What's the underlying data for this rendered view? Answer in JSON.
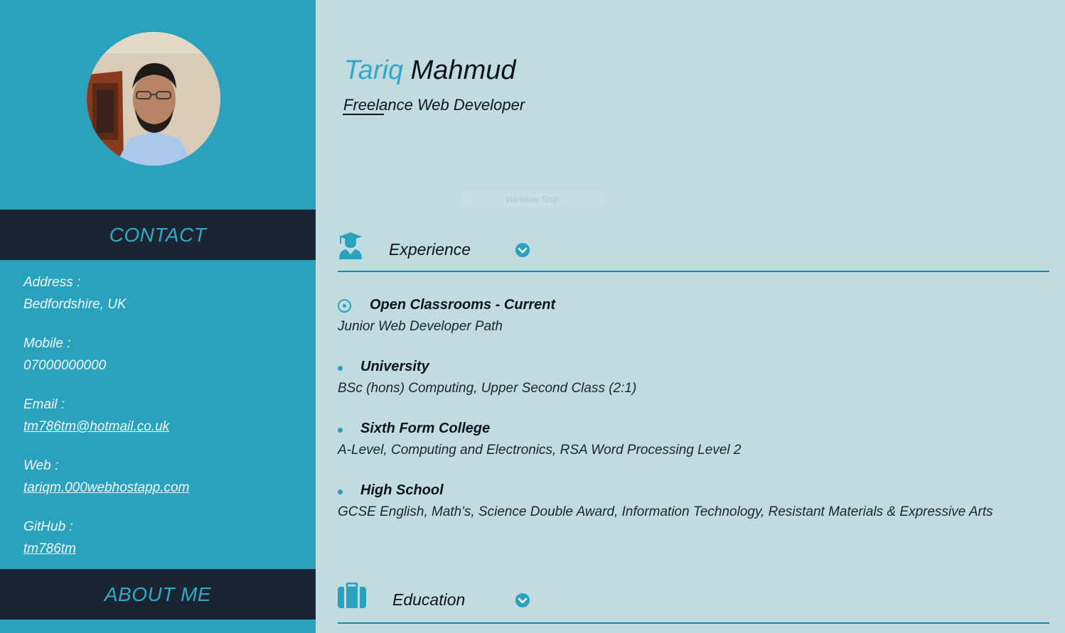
{
  "profile": {
    "first_name": "Tariq",
    "last_name": "Mahmud",
    "role": "Freelance Web Developer",
    "ghost_text": "Window Snip"
  },
  "sidebar": {
    "contact_heading": "CONTACT",
    "about_heading": "ABOUT ME",
    "contact": [
      {
        "label": "Address :",
        "value": "Bedfordshire, UK",
        "link": false
      },
      {
        "label": "Mobile :",
        "value": "07000000000",
        "link": false
      },
      {
        "label": "Email :",
        "value": "tm786tm@hotmail.co.uk",
        "link": true
      },
      {
        "label": "Web :",
        "value": "tariqm.000webhostapp.com",
        "link": true
      },
      {
        "label": "GitHub :",
        "value": "tm786tm",
        "link": true
      }
    ]
  },
  "sections": {
    "experience": {
      "title": "Experience",
      "icon": "graduate-icon",
      "toggle_icon": "chevron-down-icon"
    },
    "education": {
      "title": "Education",
      "icon": "briefcase-icon",
      "toggle_icon": "chevron-down-icon"
    }
  },
  "experience_entries": [
    {
      "title": "Open Classrooms - Current",
      "detail": "Junior Web Developer Path",
      "marker": "target-icon"
    },
    {
      "title": "University",
      "detail": "BSc (hons) Computing, Upper Second Class (2:1)",
      "marker": "bullet"
    },
    {
      "title": "Sixth Form College",
      "detail": "A-Level, Computing and Electronics, RSA Word Processing Level 2",
      "marker": "bullet"
    },
    {
      "title": "High School",
      "detail": "GCSE English, Math's, Science Double Award, Information Technology, Resistant Materials & Expressive Arts",
      "marker": "bullet"
    }
  ],
  "colors": {
    "accent": "#2ba2bd",
    "dark_header": "#1a2534",
    "main_bg": "#c1dbe0"
  }
}
